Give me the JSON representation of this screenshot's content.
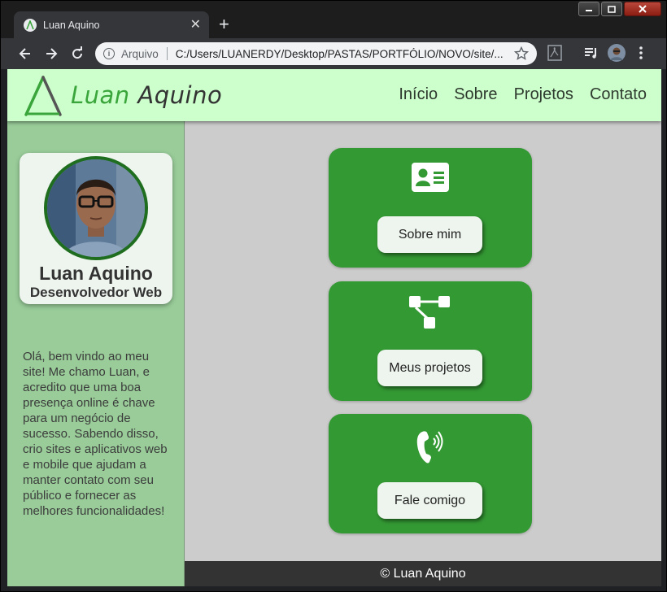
{
  "browser": {
    "tab_title": "Luan Aquino",
    "scheme_label": "Arquivo",
    "url": "C:/Users/LUANERDY/Desktop/PASTAS/PORTFÓLIO/NOVO/site/..."
  },
  "site": {
    "logo_first": "Luan",
    "logo_last": "Aquino",
    "nav": [
      {
        "label": "Início"
      },
      {
        "label": "Sobre"
      },
      {
        "label": "Projetos"
      },
      {
        "label": "Contato"
      }
    ]
  },
  "sidebar": {
    "name": "Luan Aquino",
    "role": "Desenvolvedor Web",
    "intro": "Olá, bem vindo ao meu site! Me chamo Luan, e acredito que uma boa presença online é chave para um negócio de sucesso. Sabendo disso, crio sites e aplicativos web e mobile que ajudam a manter contato com seu público e fornecer as melhores funcionalidades!"
  },
  "cards": [
    {
      "icon": "id-card-icon",
      "button": "Sobre mim"
    },
    {
      "icon": "sitemap-icon",
      "button": "Meus projetos"
    },
    {
      "icon": "phone-volume-icon",
      "button": "Fale comigo"
    }
  ],
  "footer": {
    "text": "© Luan Aquino"
  },
  "colors": {
    "header_bg": "#ccffcc",
    "sidebar_bg": "#99cc99",
    "card_green": "#339933",
    "content_bg": "#cccccc",
    "footer_bg": "#333333"
  }
}
